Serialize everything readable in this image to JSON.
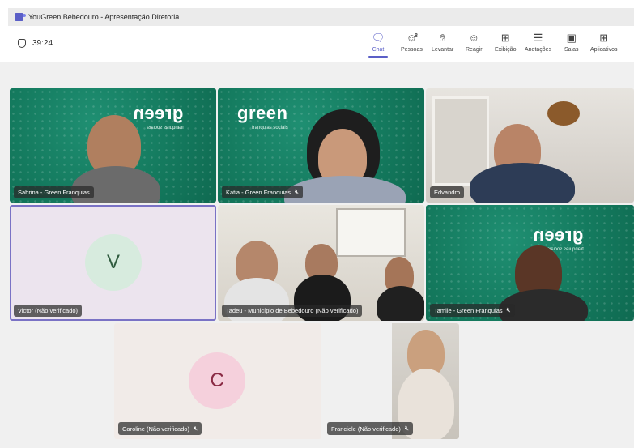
{
  "window": {
    "title": "YouGreen Bebedouro - Apresentação Diretoria"
  },
  "meeting": {
    "timer": "39:24"
  },
  "toolbar": {
    "items": [
      {
        "label": "Chat",
        "icon": "chat-icon",
        "active": true
      },
      {
        "label": "Pessoas",
        "icon": "people-icon",
        "badge": "8"
      },
      {
        "label": "Levantar",
        "icon": "raise-hand-icon"
      },
      {
        "label": "Reagir",
        "icon": "react-icon"
      },
      {
        "label": "Exibição",
        "icon": "view-icon"
      },
      {
        "label": "Anotações",
        "icon": "notes-icon"
      },
      {
        "label": "Salas",
        "icon": "rooms-icon"
      },
      {
        "label": "Aplicativos",
        "icon": "apps-icon"
      }
    ]
  },
  "participants": [
    {
      "name": "Sabrina - Green Franquias",
      "muted": false,
      "video": true
    },
    {
      "name": "Katia - Green Franquias",
      "muted": true,
      "video": true
    },
    {
      "name": "Edvandro",
      "muted": false,
      "video": true
    },
    {
      "name": "Victor (Não verificado)",
      "muted": false,
      "video": false,
      "initial": "V",
      "avatar_color": "#d7ebde",
      "initial_color": "#2f5b3e"
    },
    {
      "name": "Tadeu - Município de Bebedouro (Não verificado)",
      "muted": false,
      "video": true
    },
    {
      "name": "Tamile - Green Franquias",
      "muted": true,
      "video": true
    },
    {
      "name": "Caroline (Não verificado)",
      "muted": true,
      "video": false,
      "initial": "C",
      "avatar_color": "#f5d0dc",
      "initial_color": "#8a2a44"
    },
    {
      "name": "Franciele (Não verificado)",
      "muted": true,
      "video": true
    }
  ],
  "branding": {
    "logo_text": "green",
    "logo_subtext": "franquias sociais"
  },
  "colors": {
    "accent": "#5b5fc7",
    "brand_green": "#147a5e"
  }
}
